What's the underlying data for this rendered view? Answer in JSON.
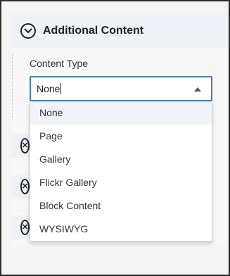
{
  "section": {
    "title": "Additional Content",
    "toggle_icon": "chevron-down-icon"
  },
  "field": {
    "label": "Content Type",
    "value": "None"
  },
  "dropdown": {
    "options": [
      "None",
      "Page",
      "Gallery",
      "Flickr Gallery",
      "Block Content",
      "WYSIWYG"
    ],
    "selected": "None"
  },
  "colors": {
    "focus_border": "#4a7fb0",
    "header_bg": "#eef1f5",
    "highlight_bg": "#f0f4f8"
  }
}
